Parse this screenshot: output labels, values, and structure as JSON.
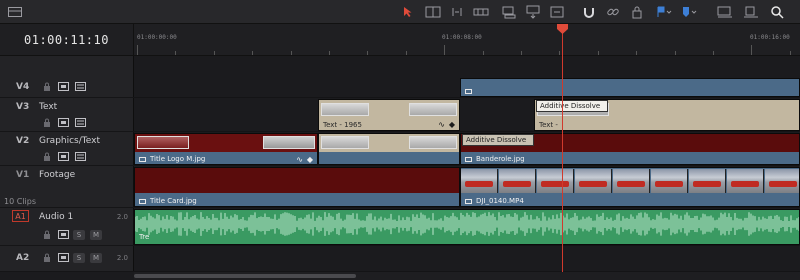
{
  "toolbar": {
    "icons": [
      "layout-icon",
      "selection-arrow-icon",
      "trim-icon",
      "dynamic-trim-icon",
      "blade-icon",
      "insert-clip-icon",
      "overwrite-clip-icon",
      "replace-clip-icon",
      "snapping-icon",
      "linked-selection-icon",
      "position-lock-icon",
      "flag-icon",
      "marker-icon",
      "zoom-full-icon",
      "zoom-detail-icon",
      "zoom-custom-icon"
    ],
    "accent_color": "#e04b3a"
  },
  "timecode": "01:00:11:10",
  "ruler": {
    "labels": [
      "01:00:00:00",
      "01:00:08:00",
      "01:00:16:00"
    ]
  },
  "tracks": {
    "v4": {
      "id": "V4"
    },
    "v3": {
      "id": "V3",
      "name": "Text"
    },
    "v2": {
      "id": "V2",
      "name": "Graphics/Text"
    },
    "v1": {
      "id": "V1",
      "name": "Footage",
      "clip_count": "10 Clips"
    },
    "a1": {
      "id": "A1",
      "name": "Audio 1",
      "volume": "2.0",
      "solo": "S",
      "mute": "M"
    },
    "a2": {
      "id": "A2",
      "volume": "2.0",
      "solo": "S",
      "mute": "M"
    }
  },
  "clips": {
    "v3_text": "Text - 1965",
    "v3_text2": "Text - ",
    "v3_transition": "Additive Dissolve",
    "v2_title_logo": "Title Logo M.jpg",
    "v2_banderole": "Banderole.jpg",
    "v2_transition": "Additive Dissolve",
    "v1_title_card": "Title Card.jpg",
    "v1_footage": "DJI_0140.MP4",
    "a1_clip": "Tre"
  },
  "colors": {
    "title_clip": "#c2b7a0",
    "video_clip": "#4b6a88",
    "maroon_clip": "#5a0c0c",
    "audio_clip": "#3a9a62",
    "playhead": "#d03a2d"
  }
}
